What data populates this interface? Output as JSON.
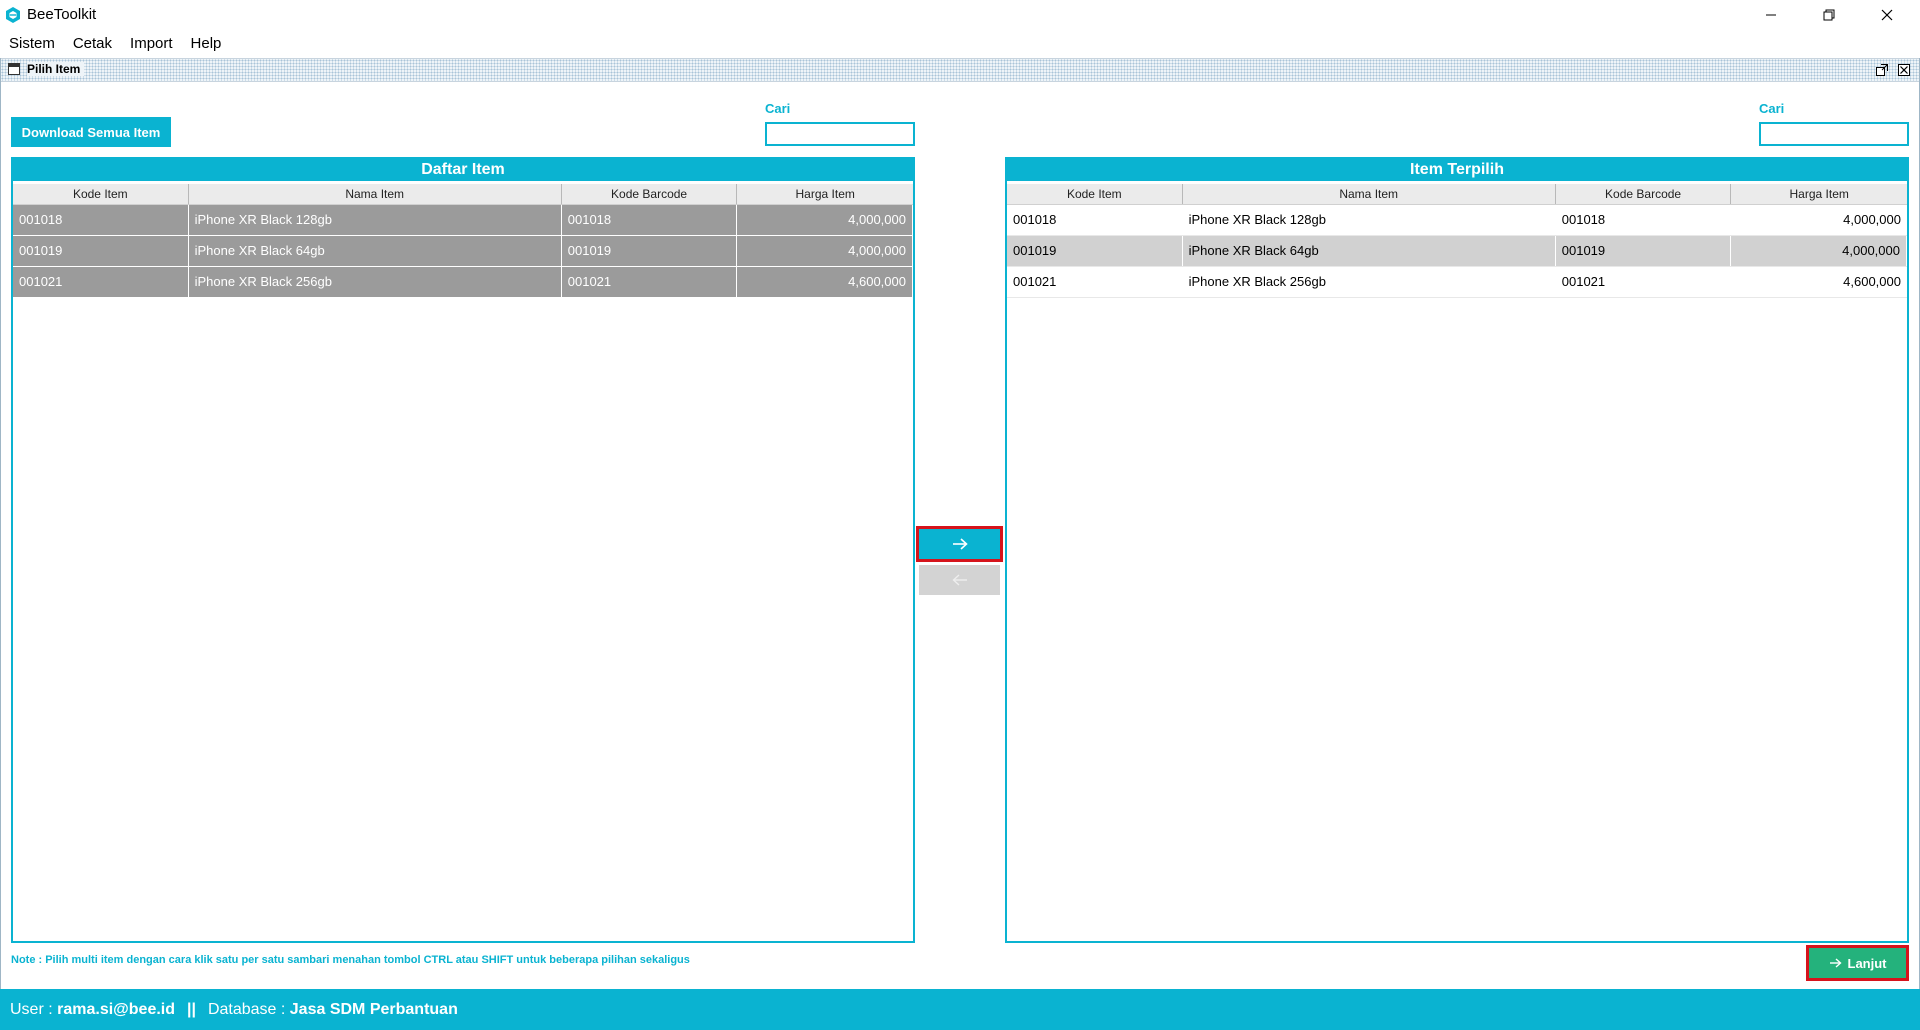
{
  "window": {
    "app_title": "BeeToolkit"
  },
  "menu": {
    "items": [
      "Sistem",
      "Cetak",
      "Import",
      "Help"
    ]
  },
  "frame": {
    "title": "Pilih Item"
  },
  "toolbar": {
    "download_label": "Download Semua Item"
  },
  "search_left": {
    "label": "Cari",
    "value": ""
  },
  "search_right": {
    "label": "Cari",
    "value": ""
  },
  "left_panel": {
    "title": "Daftar Item",
    "columns": [
      "Kode Item",
      "Nama Item",
      "Kode Barcode",
      "Harga Item"
    ],
    "rows": [
      {
        "kode": "001018",
        "nama": "iPhone XR Black 128gb",
        "barcode": "001018",
        "harga": "4,000,000"
      },
      {
        "kode": "001019",
        "nama": "iPhone XR Black 64gb",
        "barcode": "001019",
        "harga": "4,000,000"
      },
      {
        "kode": "001021",
        "nama": "iPhone XR Black 256gb",
        "barcode": "001021",
        "harga": "4,600,000"
      }
    ]
  },
  "right_panel": {
    "title": "Item Terpilih",
    "columns": [
      "Kode Item",
      "Nama Item",
      "Kode Barcode",
      "Harga Item"
    ],
    "rows": [
      {
        "kode": "001018",
        "nama": "iPhone XR Black 128gb",
        "barcode": "001018",
        "harga": "4,000,000"
      },
      {
        "kode": "001019",
        "nama": "iPhone XR Black 64gb",
        "barcode": "001019",
        "harga": "4,000,000"
      },
      {
        "kode": "001021",
        "nama": "iPhone XR Black 256gb",
        "barcode": "001021",
        "harga": "4,600,000"
      }
    ]
  },
  "note": "Note : Pilih multi item dengan cara klik satu per satu sambari menahan tombol CTRL atau SHIFT untuk beberapa pilihan sekaligus",
  "next_button": {
    "label": "Lanjut"
  },
  "status": {
    "user_label": "User : ",
    "user_value": "rama.si@bee.id",
    "separator": "||",
    "db_label": "Database : ",
    "db_value": "Jasa SDM Perbantuan"
  },
  "colors": {
    "accent": "#0ab3d1",
    "selected_row": "#9b9b9b",
    "highlight_row": "#d1d1d1",
    "next_button": "#24b27c",
    "callout_border": "#d6141c"
  },
  "icons": {
    "app": "bee-logo-icon",
    "add": "arrow-right-icon",
    "remove": "arrow-left-icon",
    "next": "arrow-right-icon"
  }
}
